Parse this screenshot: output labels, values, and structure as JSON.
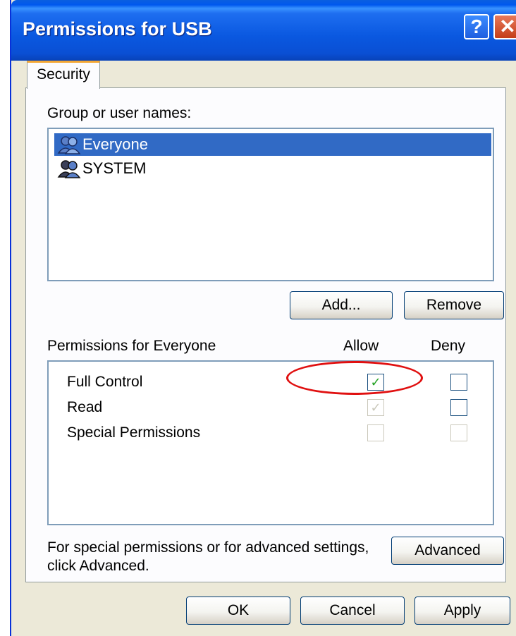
{
  "window": {
    "title": "Permissions for USB",
    "help_glyph": "?",
    "close_glyph": "✕"
  },
  "tabs": [
    {
      "label": "Security"
    }
  ],
  "group_section": {
    "label": "Group or user names:",
    "users": [
      {
        "name": "Everyone",
        "icon": "users-group-icon",
        "selected": true
      },
      {
        "name": "SYSTEM",
        "icon": "users-group-icon",
        "selected": false
      }
    ],
    "add_label": "Add...",
    "remove_label": "Remove"
  },
  "permissions": {
    "label": "Permissions for Everyone",
    "allow_header": "Allow",
    "deny_header": "Deny",
    "rows": [
      {
        "name": "Full Control",
        "allow": "✓",
        "deny": ""
      },
      {
        "name": "Read",
        "allow": "✓",
        "deny": ""
      },
      {
        "name": "Special Permissions",
        "allow": "",
        "deny": ""
      }
    ]
  },
  "advanced": {
    "text_line1": "For special permissions or for advanced settings,",
    "text_line2": "click Advanced.",
    "button_label": "Advanced"
  },
  "footer": {
    "ok_label": "OK",
    "cancel_label": "Cancel",
    "apply_label": "Apply"
  },
  "colors": {
    "title_bar": "#0a58e0",
    "selection": "#316ac5",
    "annotation": "#e01010",
    "check": "#21a121"
  }
}
